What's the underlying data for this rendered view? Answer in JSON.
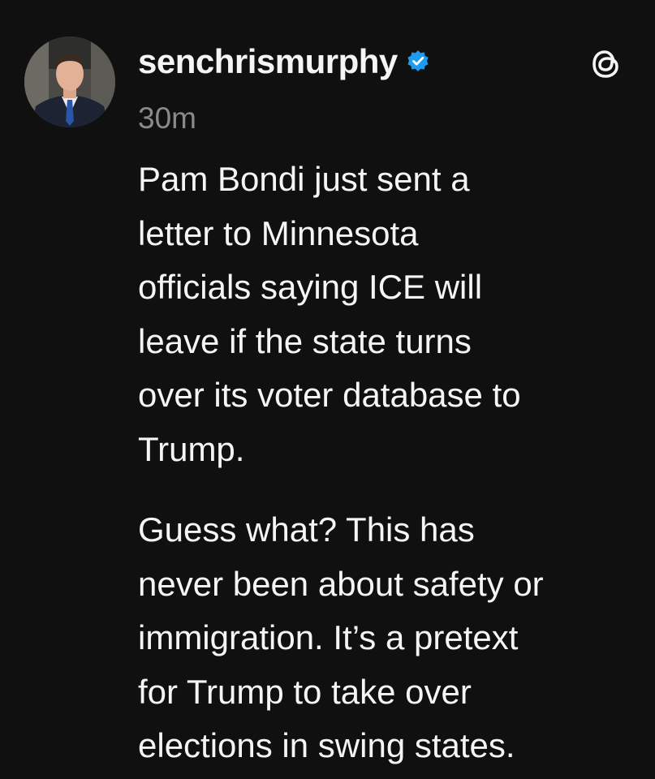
{
  "post": {
    "username": "senchrismurphy",
    "verified_icon": "verified-badge-icon",
    "verified_color": "#1d9bf0",
    "timestamp": "30m",
    "app_logo": "threads-logo-icon",
    "paragraphs": [
      "Pam Bondi just sent a\nletter to Minnesota\nofficials saying ICE will\nleave if the state turns\nover its voter database to\nTrump.",
      "Guess what? This has\nnever been about safety or\nimmigration. It’s a pretext\nfor Trump to take over\nelections in swing states."
    ]
  },
  "colors": {
    "background": "#101010",
    "text": "#f3f5f7",
    "secondary_text": "#8a8a8a"
  }
}
